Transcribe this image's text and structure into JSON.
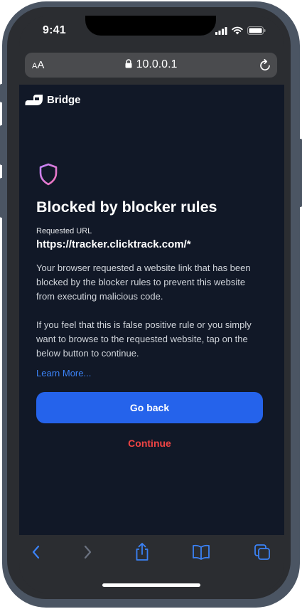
{
  "status_bar": {
    "time": "9:41"
  },
  "browser": {
    "aa_label_small": "A",
    "aa_label_large": "A",
    "url": "10.0.0.1"
  },
  "brand": {
    "name": "Bridge"
  },
  "page": {
    "title": "Blocked by blocker rules",
    "requested_url_label": "Requested URL",
    "requested_url": "https://tracker.clicktrack.com/*",
    "paragraph_1": "Your browser requested a website link that has been blocked by the blocker rules to prevent this website from executing malicious code.",
    "paragraph_2": "If you feel that this is false positive rule or you simply want to browse to the requested website, tap on the below button to continue.",
    "learn_more": "Learn More...",
    "go_back": "Go back",
    "continue": "Continue"
  },
  "toolbar": {
    "icons": [
      "back-icon",
      "forward-icon",
      "share-icon",
      "bookmarks-icon",
      "tabs-icon"
    ]
  },
  "colors": {
    "page_background": "#111827",
    "primary_button": "#2563eb",
    "link": "#3b82f6",
    "danger": "#ef4444",
    "shield_gradient_start": "#c084fc",
    "shield_gradient_end": "#f472b6"
  }
}
